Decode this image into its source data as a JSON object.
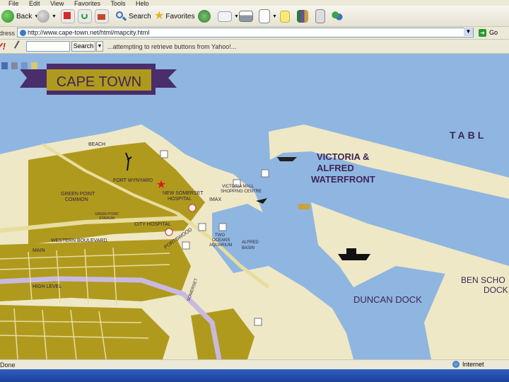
{
  "menubar": {
    "items": [
      "File",
      "Edit",
      "View",
      "Favorites",
      "Tools",
      "Help"
    ]
  },
  "toolbar": {
    "back_label": "Back",
    "search_label": "Search",
    "favorites_label": "Favorites"
  },
  "addressbar": {
    "label": "Address",
    "url": "http://www.cape-town.net/html/mapcity.html",
    "go_label": "Go"
  },
  "yahoobar": {
    "logo": "Y!",
    "search_label": "Search",
    "message": "...attempting to retrieve buttons from Yahoo!..."
  },
  "map": {
    "banner_title": "CAPE TOWN",
    "labels": {
      "table": "TABL",
      "waterfront_1": "VICTORIA &",
      "waterfront_2": "ALFRED",
      "waterfront_3": "WATERFRONT",
      "duncan_dock": "DUNCAN DOCK",
      "ben_1": "BEN SCHO",
      "ben_2": "DOCK",
      "beach": "BEACH",
      "fort_wynyard": "FORT WYNYARD",
      "new_somerset_1": "NEW SOMERSET",
      "new_somerset_2": "HOSPITAL",
      "green_point_1": "GREEN POINT",
      "green_point_2": "COMMON",
      "green_point_stadium_1": "GREEN POINT",
      "green_point_stadium_2": "STADIUM",
      "city_hospital": "CITY HOSPITAL",
      "western_boulevard": "WESTERN BOULEVARD",
      "portswood": "PORTSWOOD",
      "main": "MAIN",
      "high_level": "HIGH LEVEL",
      "va_mall_1": "VICTORIA MALL",
      "va_mall_2": "SHOPPING CENTRE",
      "imax": "IMAX",
      "two_oceans_1": "TWO",
      "two_oceans_2": "OCEANS",
      "two_oceans_3": "AQUARIUM",
      "alfred_basin_1": "ALFRED",
      "alfred_basin_2": "BASIN",
      "somerset": "SOMERSET"
    }
  },
  "statusbar": {
    "text": "Done",
    "zone": "Internet"
  },
  "colors": {
    "land": "#b09a1e",
    "sea": "#8fb6e0",
    "road": "#f0e6b0",
    "banner": "#4a2d6b"
  }
}
